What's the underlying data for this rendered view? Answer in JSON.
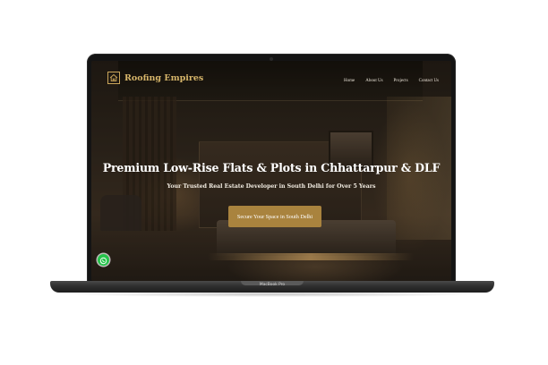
{
  "device": {
    "label": "MacBook Pro"
  },
  "nav": {
    "brand": "Roofing Empires",
    "links": [
      {
        "label": "Home"
      },
      {
        "label": "About Us"
      },
      {
        "label": "Projects"
      },
      {
        "label": "Contact Us"
      }
    ]
  },
  "hero": {
    "title": "Premium Low-Rise Flats & Plots in Chhattarpur & DLF",
    "subtitle": "Your Trusted Real Estate Developer in South Delhi for Over 5 Years",
    "cta_label": "Secure Your Space in South Delhi"
  },
  "colors": {
    "accent_gold": "#a9833e",
    "brand_gold": "#d6b56a",
    "whatsapp_green": "#25c34a"
  },
  "icons": {
    "logo": "house-icon",
    "chat": "whatsapp-icon"
  }
}
